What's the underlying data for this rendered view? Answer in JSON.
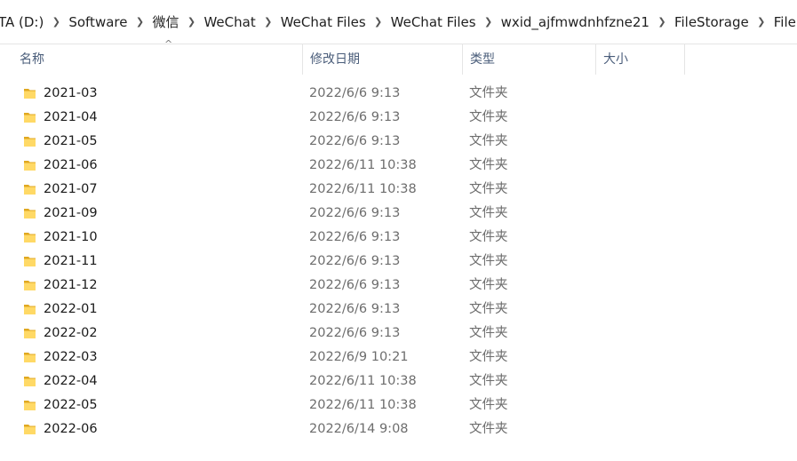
{
  "breadcrumb": [
    "TA (D:)",
    "Software",
    "微信",
    "WeChat",
    "WeChat Files",
    "WeChat Files",
    "wxid_ajfmwdnhfzne21",
    "FileStorage",
    "File"
  ],
  "breadcrumb_separator_icon": "chevron-right-icon",
  "columns": {
    "name": "名称",
    "date": "修改日期",
    "type": "类型",
    "size": "大小"
  },
  "sort_indicator": "^",
  "folder_icon_color": "#F4C542",
  "files": [
    {
      "name": "2021-03",
      "date": "2022/6/6 9:13",
      "type": "文件夹"
    },
    {
      "name": "2021-04",
      "date": "2022/6/6 9:13",
      "type": "文件夹"
    },
    {
      "name": "2021-05",
      "date": "2022/6/6 9:13",
      "type": "文件夹"
    },
    {
      "name": "2021-06",
      "date": "2022/6/11 10:38",
      "type": "文件夹"
    },
    {
      "name": "2021-07",
      "date": "2022/6/11 10:38",
      "type": "文件夹"
    },
    {
      "name": "2021-09",
      "date": "2022/6/6 9:13",
      "type": "文件夹"
    },
    {
      "name": "2021-10",
      "date": "2022/6/6 9:13",
      "type": "文件夹"
    },
    {
      "name": "2021-11",
      "date": "2022/6/6 9:13",
      "type": "文件夹"
    },
    {
      "name": "2021-12",
      "date": "2022/6/6 9:13",
      "type": "文件夹"
    },
    {
      "name": "2022-01",
      "date": "2022/6/6 9:13",
      "type": "文件夹"
    },
    {
      "name": "2022-02",
      "date": "2022/6/6 9:13",
      "type": "文件夹"
    },
    {
      "name": "2022-03",
      "date": "2022/6/9 10:21",
      "type": "文件夹"
    },
    {
      "name": "2022-04",
      "date": "2022/6/11 10:38",
      "type": "文件夹"
    },
    {
      "name": "2022-05",
      "date": "2022/6/11 10:38",
      "type": "文件夹"
    },
    {
      "name": "2022-06",
      "date": "2022/6/14 9:08",
      "type": "文件夹"
    }
  ]
}
